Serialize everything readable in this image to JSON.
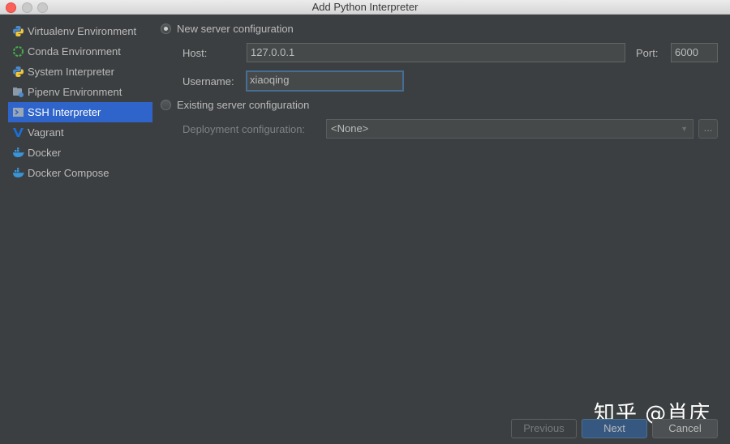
{
  "window": {
    "title": "Add Python Interpreter"
  },
  "sidebar": {
    "items": [
      {
        "label": "Virtualenv Environment",
        "icon": "python-icon"
      },
      {
        "label": "Conda Environment",
        "icon": "conda-icon"
      },
      {
        "label": "System Interpreter",
        "icon": "python-icon"
      },
      {
        "label": "Pipenv Environment",
        "icon": "pipenv-icon"
      },
      {
        "label": "SSH Interpreter",
        "icon": "terminal-icon",
        "selected": true
      },
      {
        "label": "Vagrant",
        "icon": "vagrant-icon"
      },
      {
        "label": "Docker",
        "icon": "docker-icon"
      },
      {
        "label": "Docker Compose",
        "icon": "docker-icon"
      }
    ]
  },
  "main": {
    "new_server": {
      "label": "New server configuration",
      "selected": true,
      "host_label": "Host:",
      "host_value": "127.0.0.1",
      "port_label": "Port:",
      "port_value": "6000",
      "username_label": "Username:",
      "username_value": "xiaoqing"
    },
    "existing_server": {
      "label": "Existing server configuration",
      "selected": false,
      "deployment_label": "Deployment configuration:",
      "deployment_value": "<None>",
      "browse_label": "..."
    }
  },
  "footer": {
    "previous_label": "Previous",
    "next_label": "Next",
    "cancel_label": "Cancel"
  },
  "watermark": "知乎 @肖庆",
  "colors": {
    "background": "#3c3f41",
    "selection": "#2f65ca",
    "accent": "#365880"
  }
}
